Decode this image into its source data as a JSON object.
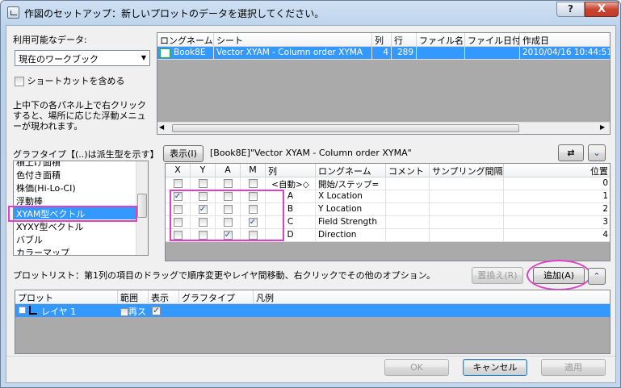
{
  "window": {
    "title": "作図のセットアップ：新しいプロットのデータを選択してください。",
    "help_label": "?",
    "close_label": "X"
  },
  "left": {
    "available_label": "利用可能なデータ:",
    "combo_value": "現在のワークブック",
    "shortcut_label": "ショートカットを含める",
    "hint": [
      "上中下の各パネル上で右クリック",
      "すると、場所に応じた浮動メニュ",
      "ーが現われます。"
    ],
    "graphtype_label": "グラフタイプ【(..)は派生型を示す】",
    "graph_types": [
      "積上げ面積",
      "色付き面積",
      "株価(Hi-Lo-CI)",
      "浮動棒",
      "XYAM型ベクトル",
      "XYXY型ベクトル",
      "バブル",
      "カラーマップ"
    ]
  },
  "top_table": {
    "headers": [
      "ロングネーム",
      "シート",
      "列",
      "行",
      "ファイル名",
      "ファイル日付",
      "作成日"
    ],
    "row": [
      "Book8E",
      "Vector XYAM - Column order XYMA",
      "4",
      "289",
      "",
      "",
      "2010/04/16 10:44:51"
    ]
  },
  "show_button": "表示(I)",
  "path_text": "[Book8E]\"Vector XYAM - Column order XYMA\"",
  "swap_icon": "⇄",
  "collapse_icon": "⌄",
  "mid_table": {
    "headers": [
      "X",
      "Y",
      "A",
      "M",
      "列",
      "ロングネーム",
      "コメント",
      "サンプリング間隔",
      "位置"
    ],
    "rows": [
      {
        "x": false,
        "y": false,
        "a": false,
        "m": false,
        "col": "<自動>◇",
        "lname": "開始/ステップ=",
        "pos": "0"
      },
      {
        "x": true,
        "y": false,
        "a": false,
        "m": false,
        "col": "A",
        "lname": "X Location",
        "pos": "1"
      },
      {
        "x": false,
        "y": true,
        "a": false,
        "m": false,
        "col": "B",
        "lname": "Y Location",
        "pos": "2"
      },
      {
        "x": false,
        "y": false,
        "a": false,
        "m": true,
        "col": "C",
        "lname": "Field Strength",
        "pos": "3"
      },
      {
        "x": false,
        "y": false,
        "a": true,
        "m": false,
        "col": "D",
        "lname": "Direction",
        "pos": "4"
      }
    ]
  },
  "plotlist_label": "プロットリスト：第1列の項目のドラッグで順序変更やレイヤ間移動、右クリックでその他のオプション。",
  "replace_button": "置換え(R)",
  "add_button": "追加(A)",
  "expand_icon": "⌃",
  "bottom_table": {
    "headers": [
      "プロット",
      "範囲",
      "表示",
      "グラフタイプ",
      "凡例"
    ],
    "row": {
      "plot": "レイヤ 1",
      "range": "再ス"
    }
  },
  "buttons": {
    "ok": "OK",
    "cancel": "キャンセル",
    "apply": "適用"
  }
}
